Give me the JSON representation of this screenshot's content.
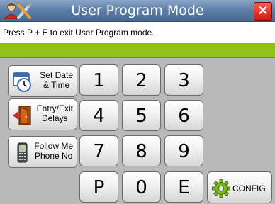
{
  "titlebar": {
    "title": "User Program Mode",
    "close_label": "✕"
  },
  "message": "Press P + E to exit User Program mode.",
  "status_color": "#8fc21c",
  "side_buttons": [
    {
      "line1": "Set Date",
      "line2": "& Time",
      "icon": "calendar-clock-icon"
    },
    {
      "line1": "Entry/Exit",
      "line2": "Delays",
      "icon": "door-icon"
    },
    {
      "line1": "Follow Me",
      "line2": "Phone No",
      "icon": "phone-icon"
    }
  ],
  "keypad": [
    "1",
    "2",
    "3",
    "4",
    "5",
    "6",
    "7",
    "8",
    "9",
    "P",
    "0",
    "E"
  ],
  "config": {
    "label": "CONFIG",
    "icon": "gear-icon"
  }
}
